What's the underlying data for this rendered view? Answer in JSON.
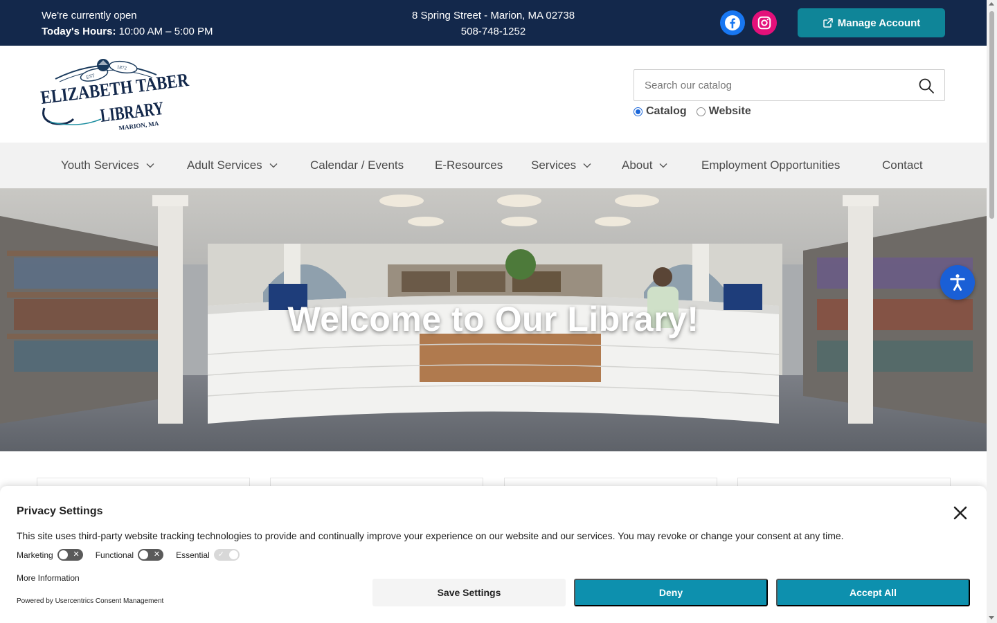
{
  "topbar": {
    "open_status": "We're currently open",
    "hours_label": "Today's Hours:",
    "hours_value": "10:00 AM – 5:00 PM",
    "address": "8 Spring Street - Marion, MA 02738",
    "phone": "508-748-1252",
    "facebook_icon": "facebook-icon",
    "instagram_icon": "instagram-icon",
    "manage_account_label": "Manage Account",
    "colors": {
      "background": "#13284b",
      "manage_button": "#0f8598",
      "facebook": "#1877f2",
      "instagram": "#e4107a"
    }
  },
  "header": {
    "logo": {
      "est": "EST",
      "year": "1872",
      "line1": "ELIZABETH TABER",
      "line2": "LIBRARY",
      "location": "MARION, MA"
    },
    "search": {
      "placeholder": "Search our catalog",
      "icon": "search-icon"
    },
    "scope": [
      {
        "label": "Catalog",
        "selected": true
      },
      {
        "label": "Website",
        "selected": false
      }
    ]
  },
  "nav": {
    "items": [
      {
        "label": "Youth Services",
        "dropdown": true
      },
      {
        "label": "Adult Services",
        "dropdown": true
      },
      {
        "label": "Calendar / Events",
        "dropdown": false
      },
      {
        "label": "E-Resources",
        "dropdown": false
      },
      {
        "label": "Services",
        "dropdown": true
      },
      {
        "label": "About",
        "dropdown": true
      },
      {
        "label": "Employment Opportunities",
        "dropdown": false
      },
      {
        "label": "Contact",
        "dropdown": false
      }
    ]
  },
  "hero": {
    "title": "Welcome to Our Library!"
  },
  "accessibility": {
    "icon": "accessibility-icon",
    "color": "#1a5fd6"
  },
  "consent": {
    "title": "Privacy Settings",
    "description": "This site uses third-party website tracking technologies to provide and continually improve your experience on our website and our services. You may revoke or change your consent at any time.",
    "toggles": [
      {
        "label": "Marketing",
        "enabled": false
      },
      {
        "label": "Functional",
        "enabled": false
      },
      {
        "label": "Essential",
        "enabled": true,
        "locked": true
      }
    ],
    "more_info": "More Information",
    "powered_by": "Powered by Usercentrics Consent Management",
    "buttons": {
      "save": "Save Settings",
      "deny": "Deny",
      "accept": "Accept All"
    },
    "colors": {
      "primary_button": "#0d90ae"
    }
  }
}
